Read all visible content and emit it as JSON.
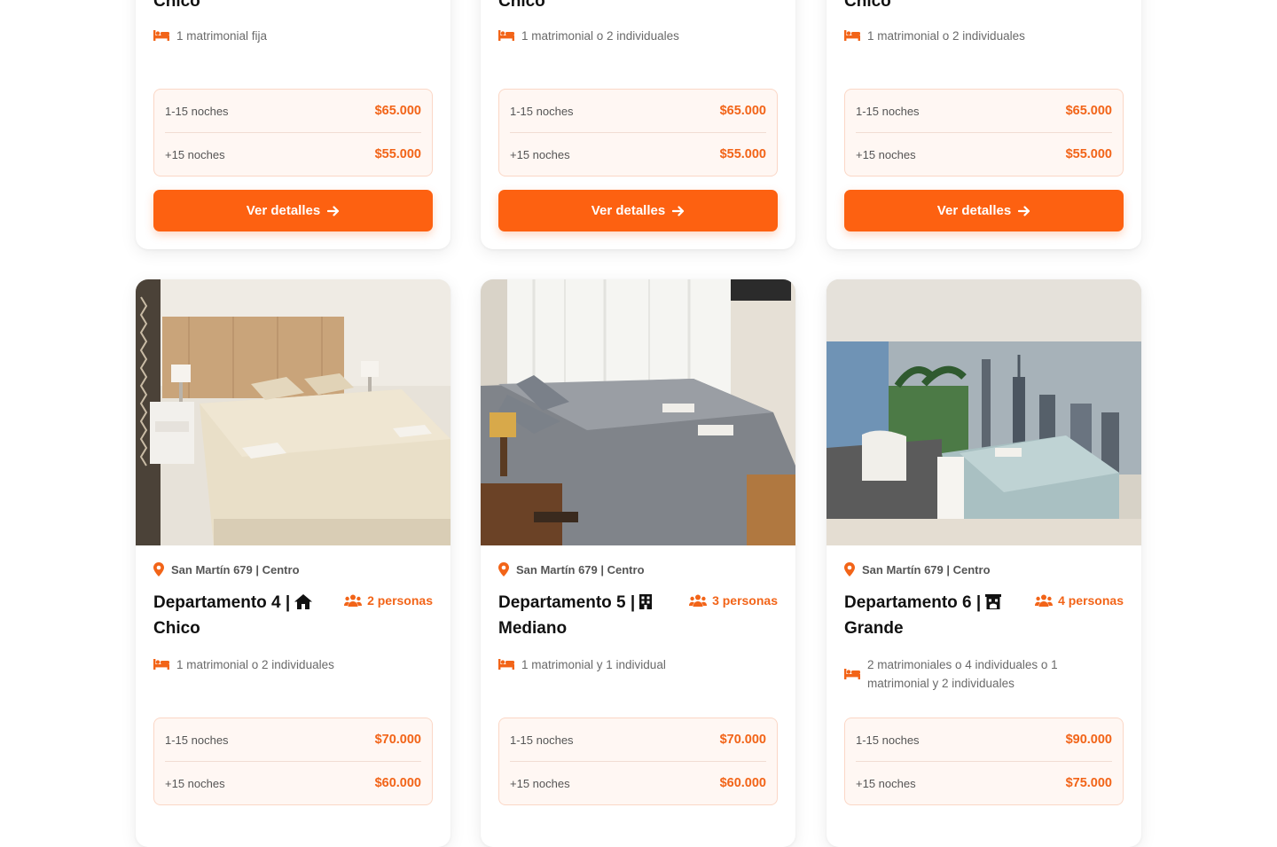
{
  "colors": {
    "accent": "#fd6111",
    "accent_text": "#f26418",
    "price_bg": "#fff7f3",
    "price_border": "#fbd7c6"
  },
  "cards_top": [
    {
      "title": "Chico",
      "beds": "1 matrimonial fija",
      "prices": [
        {
          "label": "1-15 noches",
          "value": "$65.000"
        },
        {
          "label": "+15 noches",
          "value": "$55.000"
        }
      ],
      "button": "Ver detalles"
    },
    {
      "title": "Chico",
      "beds": "1 matrimonial o 2 individuales",
      "prices": [
        {
          "label": "1-15 noches",
          "value": "$65.000"
        },
        {
          "label": "+15 noches",
          "value": "$55.000"
        }
      ],
      "button": "Ver detalles"
    },
    {
      "title": "Chico",
      "beds": "1 matrimonial o 2 individuales",
      "prices": [
        {
          "label": "1-15 noches",
          "value": "$65.000"
        },
        {
          "label": "+15 noches",
          "value": "$55.000"
        }
      ],
      "button": "Ver detalles"
    }
  ],
  "cards": [
    {
      "location": "San Martín 679 | Centro",
      "title": "Departamento 4 |",
      "size": "Chico",
      "type_icon": "house-icon",
      "persons": "2 personas",
      "beds": "1 matrimonial o 2 individuales",
      "prices": [
        {
          "label": "1-15 noches",
          "value": "$70.000"
        },
        {
          "label": "+15 noches",
          "value": "$60.000"
        }
      ]
    },
    {
      "location": "San Martín 679 | Centro",
      "title": "Departamento 5 |",
      "size": "Mediano",
      "type_icon": "building-icon",
      "persons": "3 personas",
      "beds": "1 matrimonial y 1 individual",
      "prices": [
        {
          "label": "1-15 noches",
          "value": "$70.000"
        },
        {
          "label": "+15 noches",
          "value": "$60.000"
        }
      ]
    },
    {
      "location": "San Martín 679 | Centro",
      "title": "Departamento 6 |",
      "size": "Grande",
      "type_icon": "hotel-icon",
      "persons": "4 personas",
      "beds": "2 matrimoniales o 4 individuales o 1 matrimonial y 2 individuales",
      "prices": [
        {
          "label": "1-15 noches",
          "value": "$90.000"
        },
        {
          "label": "+15 noches",
          "value": "$75.000"
        }
      ]
    }
  ]
}
